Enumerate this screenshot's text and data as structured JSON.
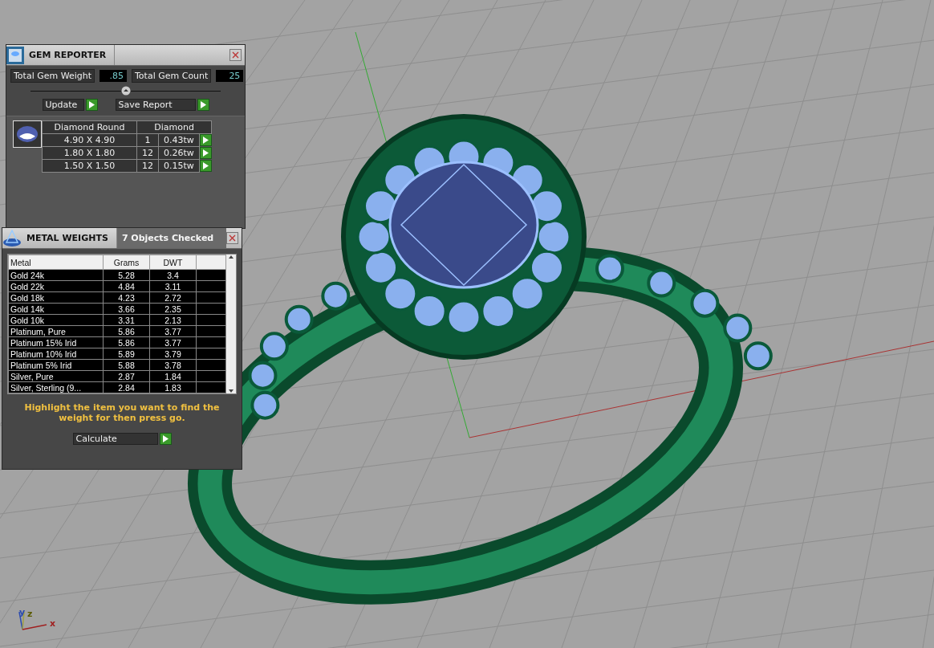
{
  "gem_reporter": {
    "title": "GEM REPORTER",
    "total_weight_label": "Total Gem Weight",
    "total_weight": ".85",
    "total_count_label": "Total Gem Count",
    "total_count": "25",
    "buttons": [
      "Update",
      "Save Report"
    ],
    "table": {
      "shape": "Diamond Round",
      "material": "Diamond",
      "rows": [
        {
          "size": "4.90 X 4.90",
          "count": "1",
          "weight": "0.43tw"
        },
        {
          "size": "1.80 X 1.80",
          "count": "12",
          "weight": "0.26tw"
        },
        {
          "size": "1.50 X 1.50",
          "count": "12",
          "weight": "0.15tw"
        }
      ]
    }
  },
  "metal_weights": {
    "title": "METAL WEIGHTS",
    "status": "7 Objects Checked",
    "columns": [
      "Metal",
      "Grams",
      "DWT"
    ],
    "rows": [
      {
        "metal": "Gold 24k",
        "grams": "5.28",
        "dwt": "3.4"
      },
      {
        "metal": "Gold 22k",
        "grams": "4.84",
        "dwt": "3.11"
      },
      {
        "metal": "Gold 18k",
        "grams": "4.23",
        "dwt": "2.72"
      },
      {
        "metal": "Gold 14k",
        "grams": "3.66",
        "dwt": "2.35"
      },
      {
        "metal": "Gold 10k",
        "grams": "3.31",
        "dwt": "2.13"
      },
      {
        "metal": "Platinum, Pure",
        "grams": "5.86",
        "dwt": "3.77"
      },
      {
        "metal": "Platinum 15% Irid",
        "grams": "5.86",
        "dwt": "3.77"
      },
      {
        "metal": "Platinum 10% Irid",
        "grams": "5.89",
        "dwt": "3.79"
      },
      {
        "metal": "Platinum 5% Irid",
        "grams": "5.88",
        "dwt": "3.78"
      },
      {
        "metal": "Silver, Pure",
        "grams": "2.87",
        "dwt": "1.84"
      },
      {
        "metal": "Silver, Sterling (9...",
        "grams": "2.84",
        "dwt": "1.83"
      }
    ],
    "hint": "Highlight the item you want to find the weight for then press go.",
    "button": "Calculate"
  },
  "axes": {
    "x": "x",
    "y": "y",
    "z": "z"
  }
}
